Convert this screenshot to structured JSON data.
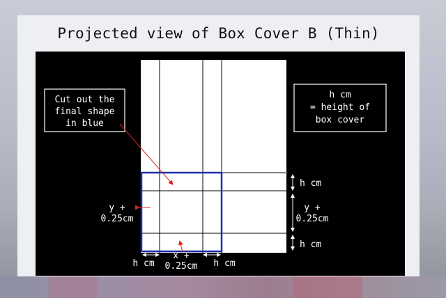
{
  "title": "Projected view of Box Cover B (Thin)",
  "callout": {
    "lines": [
      "Cut out the",
      "final shape",
      "in blue"
    ]
  },
  "legend_box": {
    "lines": [
      "h cm",
      "= height of",
      "box cover"
    ]
  },
  "dimensions": {
    "right_top": "h cm",
    "right_middle": [
      "y +",
      "0.25cm"
    ],
    "right_bottom": "h cm",
    "left_middle": [
      "y +",
      "0.25cm"
    ],
    "center_bottom": [
      "x +",
      "0.25cm"
    ],
    "bottom_left": "h cm",
    "bottom_right": "h cm"
  },
  "colors": {
    "canvas": "#000000",
    "sheet": "#ffffff",
    "cut_outline": "#1f2fa8",
    "leader_line": "#e02020",
    "dimension_lines": "#ffffff"
  }
}
